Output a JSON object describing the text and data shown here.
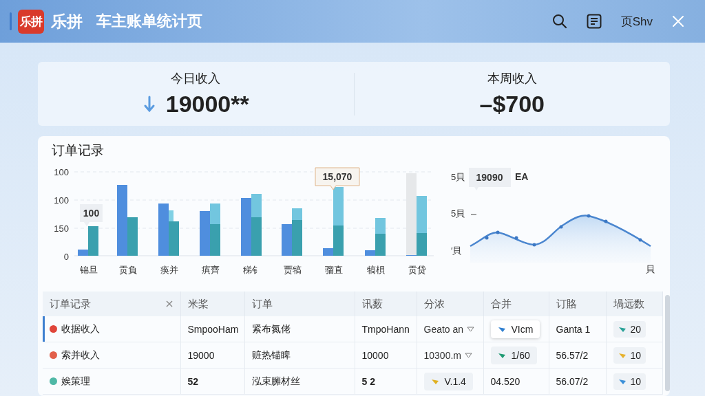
{
  "window": {
    "logo": "乐拼",
    "app_name": "乐拼",
    "title": "车主账单统计页",
    "actions": [
      {
        "kind": "search"
      },
      {
        "kind": "document"
      },
      {
        "kind": "text",
        "label": "页Shv"
      },
      {
        "kind": "close"
      }
    ]
  },
  "summary": [
    {
      "label": "今日收入",
      "value": "19000**",
      "falling": true
    },
    {
      "label": "本周收入",
      "value": "–$700",
      "falling": false
    }
  ],
  "orders": {
    "title": "订单记录",
    "bar_chart": {
      "y_labels": [
        "100",
        "100",
        "150",
        "0"
      ],
      "x_labels": [
        "锦旦",
        "贡負",
        "痪并",
        "瘨齊",
        "稊钅",
        "贾犒",
        "骝直",
        "犒梖",
        "贡贷"
      ],
      "callouts": [
        "100",
        "15,070"
      ]
    },
    "line_chart": {
      "y_labels": [
        "5貝",
        "5貝",
        "′貝"
      ],
      "callout": "19090",
      "legend": "EA",
      "x_label": "貝"
    }
  },
  "table": {
    "columns": [
      {
        "label": "订单记录",
        "closable": true
      },
      {
        "label": "米桨",
        "closable": false
      },
      {
        "label": "订单",
        "closable": false
      },
      {
        "label": "讯薮",
        "closable": false
      },
      {
        "label": "分浓",
        "closable": false
      },
      {
        "label": "合并",
        "closable": false
      },
      {
        "label": "订賂",
        "closable": false
      },
      {
        "label": "堝远数",
        "closable": false
      }
    ],
    "rows": [
      {
        "selected": true,
        "cells": [
          {
            "kind": "status",
            "text": "收据收入",
            "color": "#e0453a"
          },
          {
            "kind": "text",
            "text": "SmpooHam"
          },
          {
            "kind": "text",
            "text": "紧布氮佬"
          },
          {
            "kind": "text",
            "text": "TmpoHann"
          },
          {
            "kind": "dropdown",
            "text": "Geato an"
          },
          {
            "kind": "chip",
            "text": "VIcm",
            "color": "#2f7fd0",
            "raised": true
          },
          {
            "kind": "text",
            "text": "Ganta 1"
          },
          {
            "kind": "badge",
            "text": "20",
            "color": "#2aa198"
          }
        ]
      },
      {
        "selected": false,
        "cells": [
          {
            "kind": "status",
            "text": "索并收入",
            "color": "#e2604a"
          },
          {
            "kind": "text",
            "text": "19000"
          },
          {
            "kind": "text",
            "text": "赃热锚睥"
          },
          {
            "kind": "text",
            "text": "10000"
          },
          {
            "kind": "dropdown",
            "text": "10300.m"
          },
          {
            "kind": "chip",
            "text": "1/60",
            "color": "#1f9a72",
            "raised": false
          },
          {
            "kind": "text",
            "text": "56.57/2"
          },
          {
            "kind": "badge",
            "text": "10",
            "color": "#e6b22e"
          }
        ]
      },
      {
        "selected": false,
        "cells": [
          {
            "kind": "status",
            "text": "娭策理",
            "color": "#4fb8a6"
          },
          {
            "kind": "bold",
            "text": "52"
          },
          {
            "kind": "text",
            "text": "泓束臃材丝"
          },
          {
            "kind": "bold",
            "text": "5 2"
          },
          {
            "kind": "chip",
            "text": "V.1.4",
            "color": "#e0b020",
            "raised": false
          },
          {
            "kind": "text",
            "text": "04.520"
          },
          {
            "kind": "text",
            "text": "56.07/2"
          },
          {
            "kind": "badge",
            "text": "10",
            "color": "#3a8fd8"
          }
        ]
      }
    ]
  }
}
